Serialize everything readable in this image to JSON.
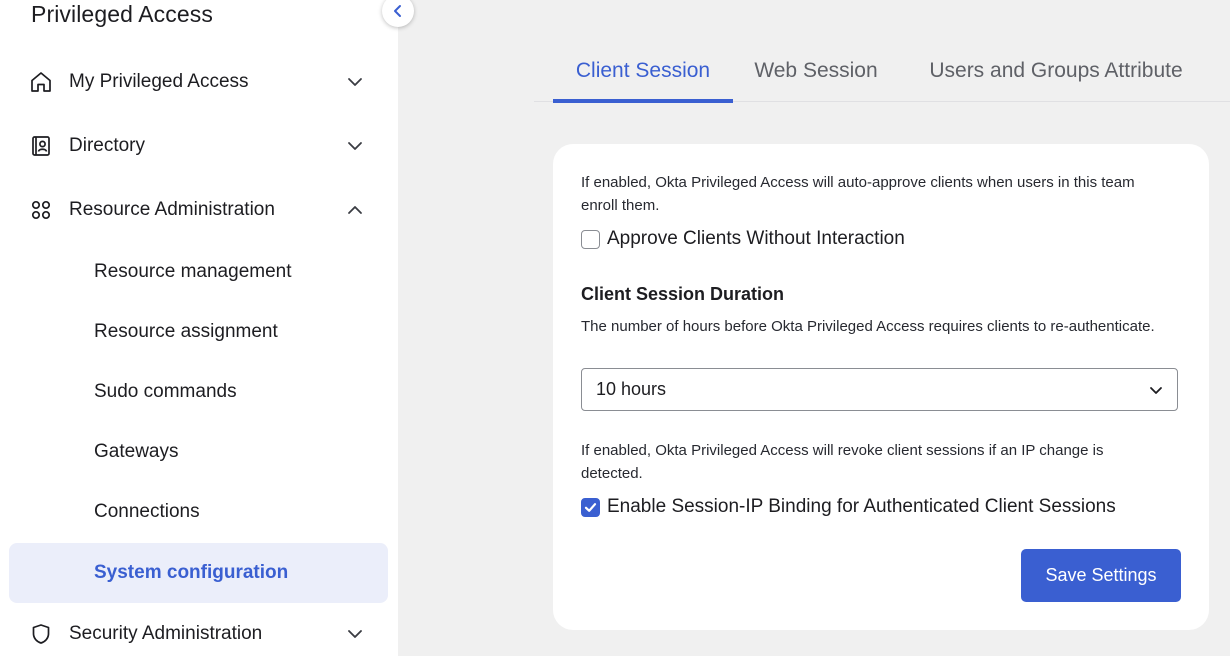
{
  "sidebar": {
    "title": "Privileged Access",
    "items": [
      {
        "label": "My Privileged Access",
        "icon": "home-icon",
        "expanded": false
      },
      {
        "label": "Directory",
        "icon": "directory-icon",
        "expanded": false
      },
      {
        "label": "Resource Administration",
        "icon": "grid-icon",
        "expanded": true
      },
      {
        "label": "Security Administration",
        "icon": "shield-icon",
        "expanded": false
      }
    ],
    "subitems": [
      {
        "label": "Resource management"
      },
      {
        "label": "Resource assignment"
      },
      {
        "label": "Sudo commands"
      },
      {
        "label": "Gateways"
      },
      {
        "label": "Connections"
      },
      {
        "label": "System configuration",
        "active": true
      }
    ]
  },
  "tabs": [
    {
      "label": "Client Session",
      "active": true
    },
    {
      "label": "Web Session",
      "active": false
    },
    {
      "label": "Users and Groups Attribute",
      "active": false
    }
  ],
  "client_session": {
    "auto_approve_desc": "If enabled, Okta Privileged Access will auto-approve clients when users in this team enroll them.",
    "approve_label": "Approve Clients Without Interaction",
    "approve_checked": false,
    "duration_title": "Client Session Duration",
    "duration_desc": "The number of hours before Okta Privileged Access requires clients to re-authenticate.",
    "duration_value": "10 hours",
    "ip_desc": "If enabled, Okta Privileged Access will revoke client sessions if an IP change is detected.",
    "ip_label": "Enable Session-IP Binding for Authenticated Client Sessions",
    "ip_checked": true,
    "save_label": "Save Settings"
  },
  "colors": {
    "accent": "#3a5fd1",
    "active_bg": "#ebeefa",
    "page_bg": "#f0f0f0"
  }
}
